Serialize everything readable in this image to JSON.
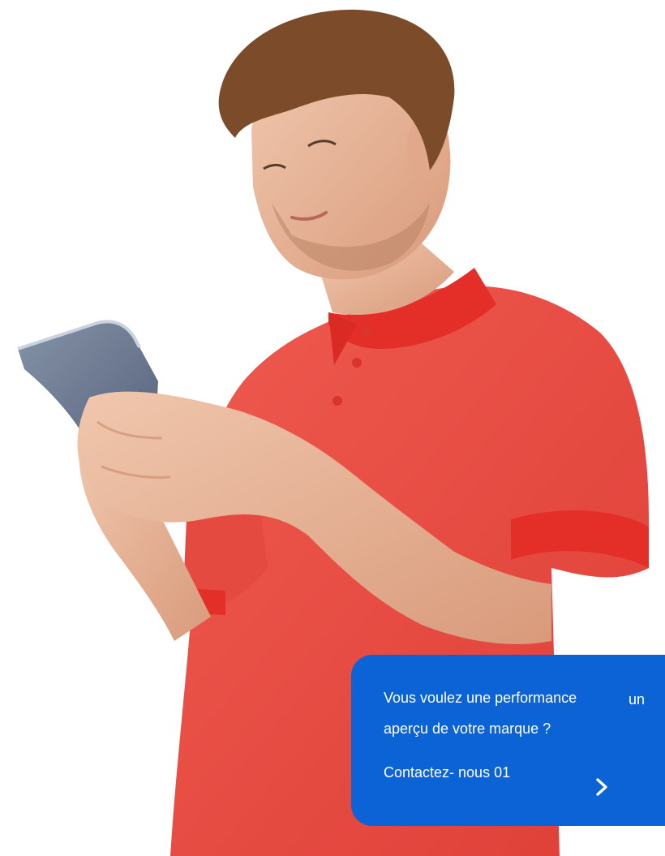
{
  "image": {
    "description_icon": "person-icon"
  },
  "colors": {
    "card_background": "#0b63d6",
    "card_text": "#ffffff",
    "shirt": "#e8453b",
    "collar": "#e42f28",
    "skin": "#e9b89b",
    "hair": "#7b4b2a",
    "phone": "#6f7d93"
  },
  "cta": {
    "line1": "Vous voulez une performance",
    "line1_suffix": "un",
    "line2": "aperçu de votre marque ?",
    "link_label": "Contactez- nous 01",
    "arrow_icon": "chevron-right-icon"
  }
}
